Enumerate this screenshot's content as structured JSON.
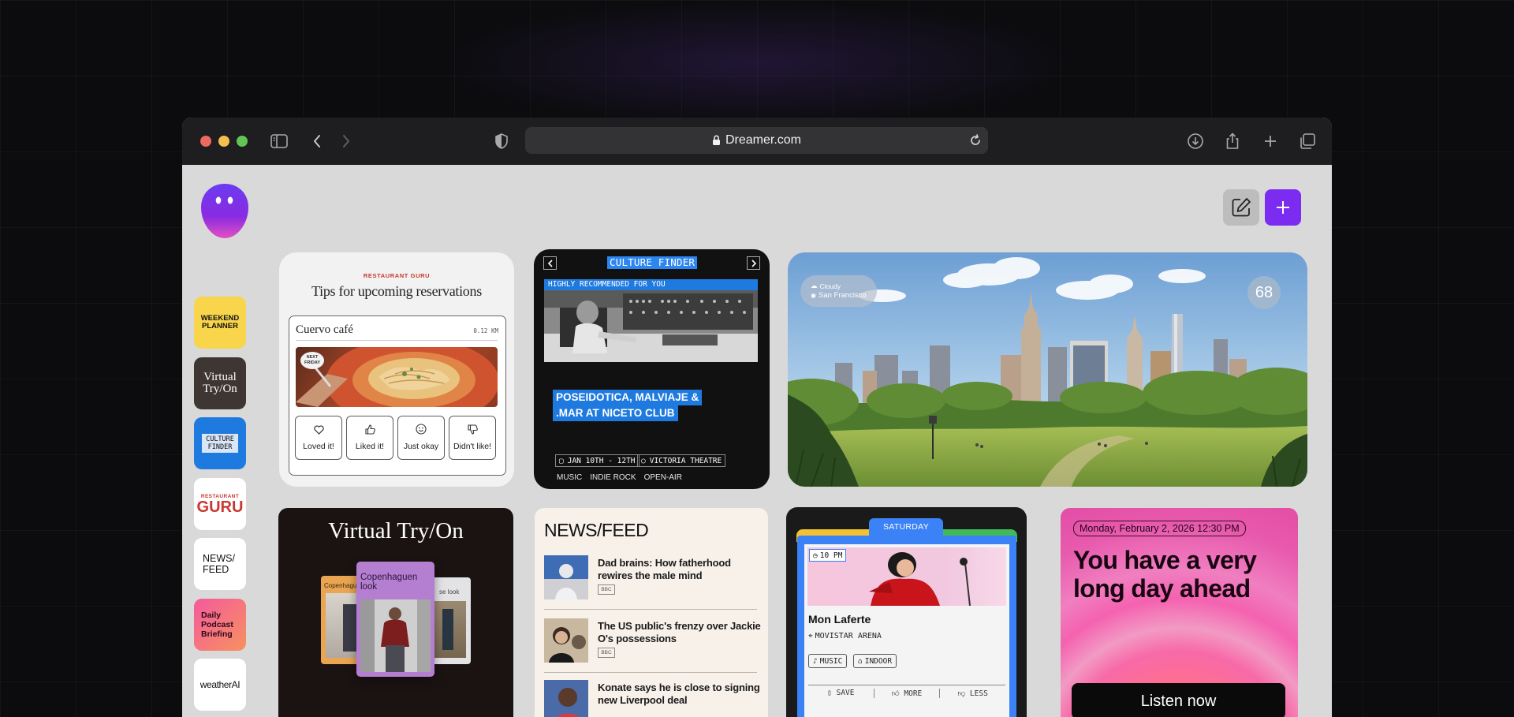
{
  "browser": {
    "url": "Dreamer.com"
  },
  "sidebar": {
    "apps": [
      {
        "label": "WEEKEND PLANNER"
      },
      {
        "label": "Virtual Try/On"
      },
      {
        "label": "CULTURE FINDER"
      },
      {
        "label_top": "RESTAURANT",
        "label_bottom": "GURU"
      },
      {
        "label": "NEWS/ FEED"
      },
      {
        "label": "Daily Podcast Briefing"
      },
      {
        "label": "weatherAI"
      }
    ]
  },
  "restaurant_card": {
    "brand": "RESTAURANT GURU",
    "title": "Tips for upcoming reservations",
    "place": "Cuervo café",
    "distance": "0.12 KM",
    "badge": "NEXT FRIDAY",
    "reactions": [
      {
        "label": "Loved it!",
        "icon": "heart-icon"
      },
      {
        "label": "Liked it!",
        "icon": "thumbs-up-icon"
      },
      {
        "label": "Just okay",
        "icon": "smile-icon"
      },
      {
        "label": "Didn't like!",
        "icon": "thumbs-down-icon"
      }
    ]
  },
  "culture_card": {
    "title": "CULTURE FINDER",
    "banner": "HIGHLY RECOMMENDED FOR YOU",
    "event_line1": "POSEIDOTICA, MALVIAJE &",
    "event_line2": ".MAR AT NICETO CLUB",
    "dates": "JAN 10TH - 12TH",
    "venue": "VICTORIA THEATRE",
    "tags": [
      "MUSIC",
      "INDIE ROCK",
      "OPEN-AIR"
    ]
  },
  "weather_card": {
    "condition": "Cloudy",
    "city": "San Francisco",
    "temperature": "68"
  },
  "tryon_card": {
    "title": "Virtual Try/On",
    "left_label": "Copenhaguen",
    "center_label": "Copenhaguen look",
    "right_label": "se look"
  },
  "news_card": {
    "title": "NEWS/FEED",
    "items": [
      {
        "headline": "Dad brains: How fatherhood rewires the male mind",
        "source": "BBC"
      },
      {
        "headline": "The US public's frenzy over Jackie O's possessions",
        "source": "BBC"
      },
      {
        "headline": "Konate says he is close to signing new Liverpool deal",
        "source": "BBC"
      }
    ]
  },
  "event_card": {
    "day": "SATURDAY",
    "time": "10 PM",
    "artist": "Mon Laferte",
    "venue": "MOVISTAR ARENA",
    "tags": [
      "MUSIC",
      "INDOOR"
    ],
    "actions": [
      "SAVE",
      "MORE",
      "LESS"
    ]
  },
  "podcast_card": {
    "datetime": "Monday, February 2, 2026 12:30 PM",
    "headline": "You have a very long day ahead",
    "button": "Listen now"
  },
  "colors": {
    "accent": "#7c3aed",
    "culture_blue": "#1f7ae0",
    "podcast_pink": "#f25aa8"
  }
}
